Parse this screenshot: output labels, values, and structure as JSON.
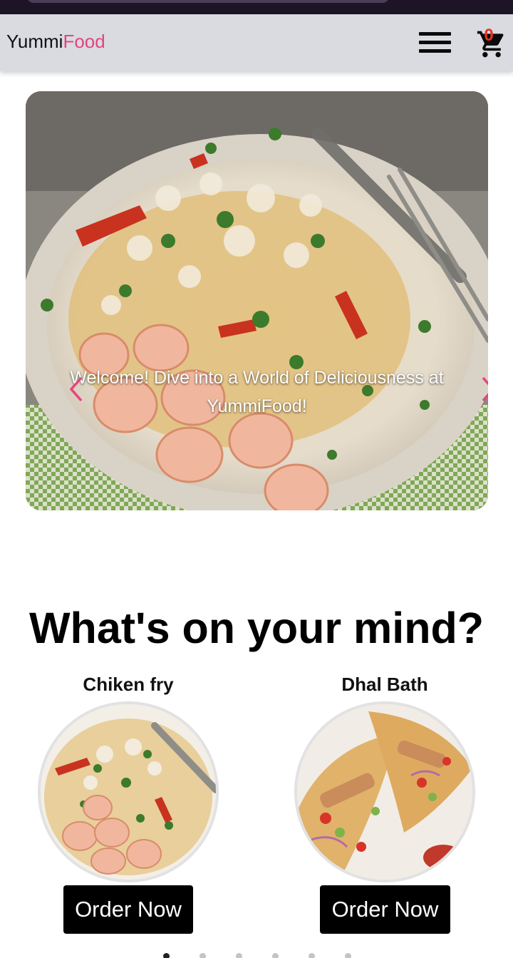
{
  "navbar": {
    "brand_part1": "Yummi",
    "brand_part2": "Food",
    "menu_icon": "hamburger-menu-icon",
    "cart_icon": "shopping-cart-icon",
    "cart_count": "0",
    "brand_accent_color": "#e5457e",
    "cart_count_color": "#e8331c"
  },
  "carousel": {
    "caption": "Welcome! Dive into a World of Deliciousness at YummiFood!",
    "prev_icon": "chevron-left-icon",
    "next_icon": "chevron-right-icon",
    "arrow_color": "#e5457e",
    "slide_count": 6,
    "active_slide": 1
  },
  "section": {
    "title": "What's on your mind?"
  },
  "dishes": [
    {
      "name": "Chiken fry",
      "button_label": "Order Now"
    },
    {
      "name": "Dhal Bath",
      "button_label": "Order Now"
    }
  ]
}
